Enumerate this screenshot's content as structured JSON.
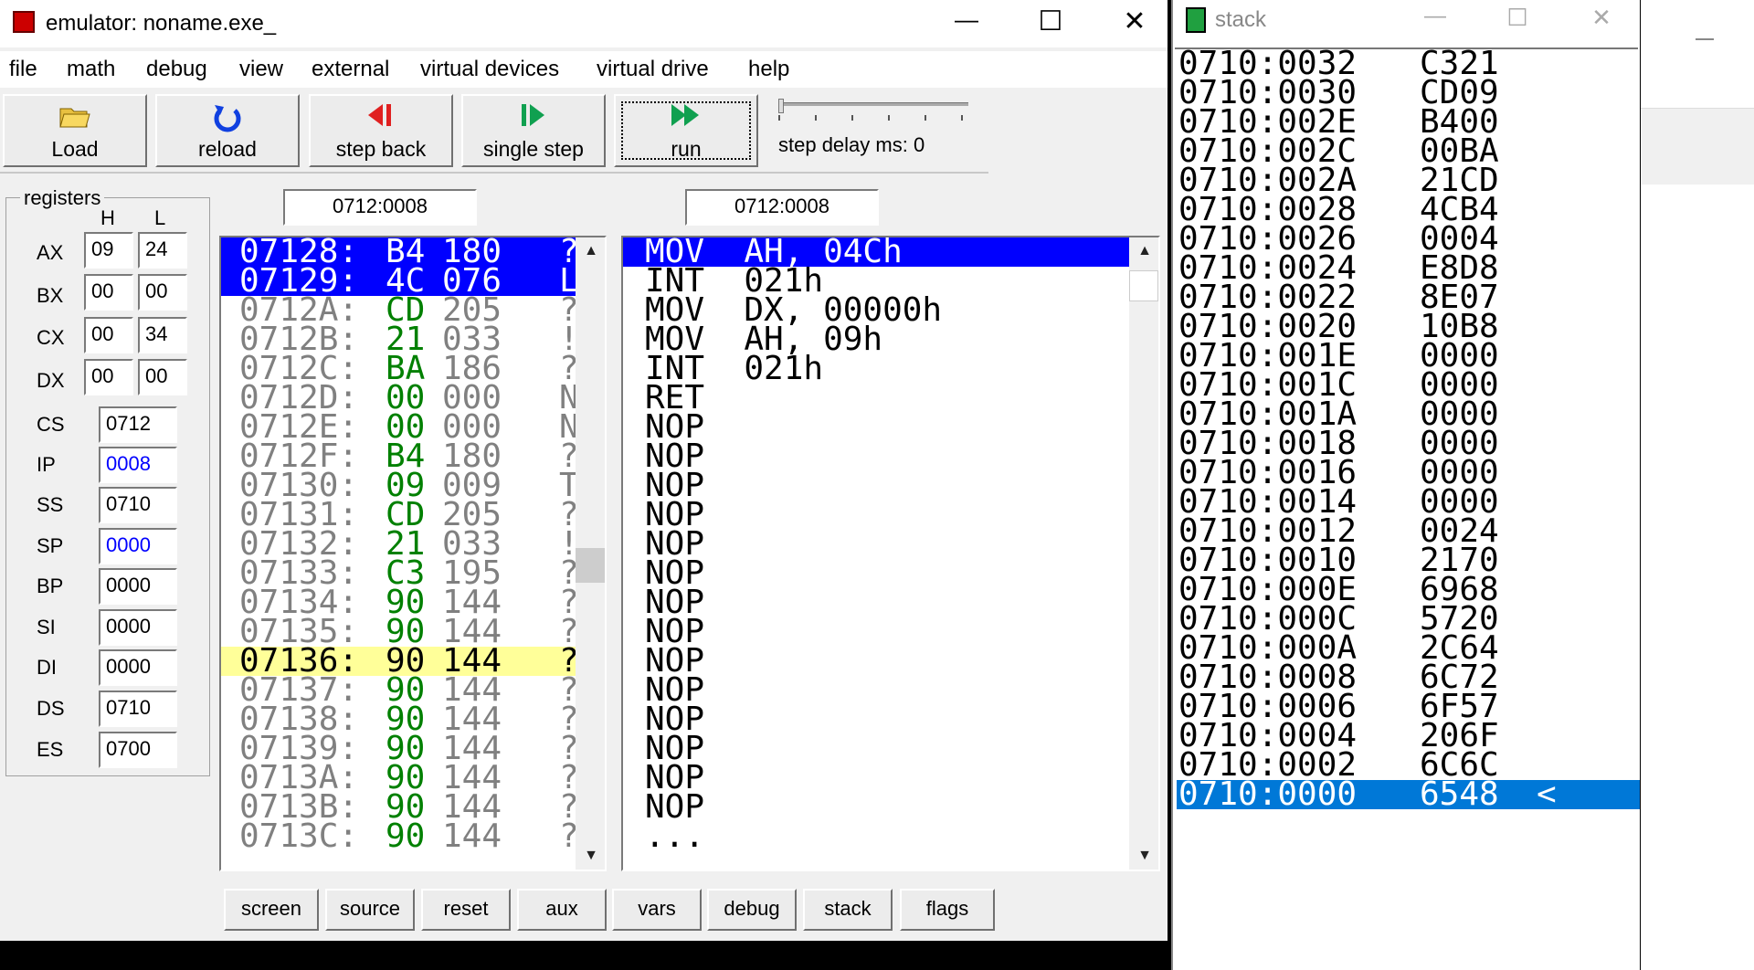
{
  "main_window": {
    "title": "emulator: noname.exe_",
    "controls": {
      "minimize": "—",
      "maximize": "☐",
      "close": "✕"
    }
  },
  "menu": [
    "file",
    "math",
    "debug",
    "view",
    "external",
    "virtual devices",
    "virtual drive",
    "help"
  ],
  "toolbar": {
    "load": "Load",
    "reload": "reload",
    "step_back": "step back",
    "single_step": "single step",
    "run": "run",
    "step_delay": "step delay ms: 0"
  },
  "registers": {
    "group_label": "registers",
    "col_h": "H",
    "col_l": "L",
    "ax": {
      "name": "AX",
      "h": "09",
      "l": "24"
    },
    "bx": {
      "name": "BX",
      "h": "00",
      "l": "00"
    },
    "cx": {
      "name": "CX",
      "h": "00",
      "l": "34"
    },
    "dx": {
      "name": "DX",
      "h": "00",
      "l": "00"
    },
    "cs": {
      "name": "CS",
      "value": "0712"
    },
    "ip": {
      "name": "IP",
      "value": "0008"
    },
    "ss": {
      "name": "SS",
      "value": "0710"
    },
    "sp": {
      "name": "SP",
      "value": "0000"
    },
    "bp": {
      "name": "BP",
      "value": "0000"
    },
    "si": {
      "name": "SI",
      "value": "0000"
    },
    "di": {
      "name": "DI",
      "value": "0000"
    },
    "ds": {
      "name": "DS",
      "value": "0710"
    },
    "es": {
      "name": "ES",
      "value": "0700"
    }
  },
  "memory_address": "0712:0008",
  "disasm_address": "0712:0008",
  "memory_lines": [
    {
      "addr": "07128:",
      "hex": "B4",
      "dec": "180",
      "chr": "?"
    },
    {
      "addr": "07129:",
      "hex": "4C",
      "dec": "076",
      "chr": "L"
    },
    {
      "addr": "0712A:",
      "hex": "CD",
      "dec": "205",
      "chr": "?"
    },
    {
      "addr": "0712B:",
      "hex": "21",
      "dec": "033",
      "chr": "!"
    },
    {
      "addr": "0712C:",
      "hex": "BA",
      "dec": "186",
      "chr": "?"
    },
    {
      "addr": "0712D:",
      "hex": "00",
      "dec": "000",
      "chr": "NU"
    },
    {
      "addr": "0712E:",
      "hex": "00",
      "dec": "000",
      "chr": "NU"
    },
    {
      "addr": "0712F:",
      "hex": "B4",
      "dec": "180",
      "chr": "?"
    },
    {
      "addr": "07130:",
      "hex": "09",
      "dec": "009",
      "chr": "TA"
    },
    {
      "addr": "07131:",
      "hex": "CD",
      "dec": "205",
      "chr": "?"
    },
    {
      "addr": "07132:",
      "hex": "21",
      "dec": "033",
      "chr": "!"
    },
    {
      "addr": "07133:",
      "hex": "C3",
      "dec": "195",
      "chr": "?"
    },
    {
      "addr": "07134:",
      "hex": "90",
      "dec": "144",
      "chr": "?"
    },
    {
      "addr": "07135:",
      "hex": "90",
      "dec": "144",
      "chr": "?"
    },
    {
      "addr": "07136:",
      "hex": "90",
      "dec": "144",
      "chr": "?"
    },
    {
      "addr": "07137:",
      "hex": "90",
      "dec": "144",
      "chr": "?"
    },
    {
      "addr": "07138:",
      "hex": "90",
      "dec": "144",
      "chr": "?"
    },
    {
      "addr": "07139:",
      "hex": "90",
      "dec": "144",
      "chr": "?"
    },
    {
      "addr": "0713A:",
      "hex": "90",
      "dec": "144",
      "chr": "?"
    },
    {
      "addr": "0713B:",
      "hex": "90",
      "dec": "144",
      "chr": "?"
    },
    {
      "addr": "0713C:",
      "hex": "90",
      "dec": "144",
      "chr": "?"
    }
  ],
  "disasm_lines": [
    "MOV  AH, 04Ch",
    "INT  021h",
    "MOV  DX, 00000h",
    "MOV  AH, 09h",
    "INT  021h",
    "RET",
    "NOP",
    "NOP",
    "NOP",
    "NOP",
    "NOP",
    "NOP",
    "NOP",
    "NOP",
    "NOP",
    "NOP",
    "NOP",
    "NOP",
    "NOP",
    "NOP",
    "..."
  ],
  "bottom_buttons": [
    "screen",
    "source",
    "reset",
    "aux",
    "vars",
    "debug",
    "stack",
    "flags"
  ],
  "stack_window": {
    "title": "stack",
    "lines": [
      {
        "addr": "0710:0032",
        "val": "C321"
      },
      {
        "addr": "0710:0030",
        "val": "CD09"
      },
      {
        "addr": "0710:002E",
        "val": "B400"
      },
      {
        "addr": "0710:002C",
        "val": "00BA"
      },
      {
        "addr": "0710:002A",
        "val": "21CD"
      },
      {
        "addr": "0710:0028",
        "val": "4CB4"
      },
      {
        "addr": "0710:0026",
        "val": "0004"
      },
      {
        "addr": "0710:0024",
        "val": "E8D8"
      },
      {
        "addr": "0710:0022",
        "val": "8E07"
      },
      {
        "addr": "0710:0020",
        "val": "10B8"
      },
      {
        "addr": "0710:001E",
        "val": "0000"
      },
      {
        "addr": "0710:001C",
        "val": "0000"
      },
      {
        "addr": "0710:001A",
        "val": "0000"
      },
      {
        "addr": "0710:0018",
        "val": "0000"
      },
      {
        "addr": "0710:0016",
        "val": "0000"
      },
      {
        "addr": "0710:0014",
        "val": "0000"
      },
      {
        "addr": "0710:0012",
        "val": "0024"
      },
      {
        "addr": "0710:0010",
        "val": "2170"
      },
      {
        "addr": "0710:000E",
        "val": "6968"
      },
      {
        "addr": "0710:000C",
        "val": "5720"
      },
      {
        "addr": "0710:000A",
        "val": "2C64"
      },
      {
        "addr": "0710:0008",
        "val": "6C72"
      },
      {
        "addr": "0710:0006",
        "val": "6F57"
      },
      {
        "addr": "0710:0004",
        "val": "206F"
      },
      {
        "addr": "0710:0002",
        "val": "6C6C"
      },
      {
        "addr": "0710:0000",
        "val": "6548",
        "marker": "<"
      }
    ]
  },
  "colors": {
    "selection_blue": "#0000ff",
    "stack_selection": "#0078d7",
    "current_line_yellow": "#ffff99",
    "hex_green": "#008000",
    "dim_gray": "#808080",
    "ip_blue": "#0000ff"
  }
}
